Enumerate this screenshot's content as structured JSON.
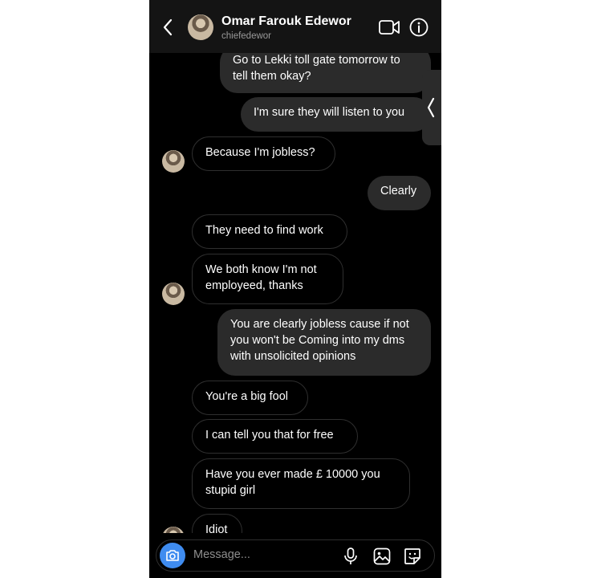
{
  "header": {
    "name": "Omar Farouk Edewor",
    "username": "chiefedewor"
  },
  "messages": [
    {
      "from": "me",
      "text": "Go to Lekki toll gate tomorrow to tell them okay?"
    },
    {
      "from": "me",
      "text": "I'm sure they will listen to you"
    },
    {
      "from": "them",
      "text": "Because I'm jobless?"
    },
    {
      "from": "me",
      "text": "Clearly"
    },
    {
      "from": "them",
      "text": "They need to find work"
    },
    {
      "from": "them",
      "text": "We both know I'm not employeed, thanks"
    },
    {
      "from": "me",
      "text": "You are clearly jobless cause if not you won't be Coming into my dms with unsolicited opinions"
    },
    {
      "from": "them",
      "text": "You're a big fool"
    },
    {
      "from": "them",
      "text": "I can tell you that for free"
    },
    {
      "from": "them",
      "text": "Have you ever made £ 10000 you stupid girl"
    },
    {
      "from": "them",
      "text": "Idiot"
    }
  ],
  "composer": {
    "placeholder": "Message..."
  },
  "icons": {
    "back": "chevron-left-icon",
    "video": "video-call-icon",
    "info": "info-icon",
    "camera": "camera-icon",
    "mic": "microphone-icon",
    "gallery": "gallery-icon",
    "sticker": "sticker-icon"
  },
  "colors": {
    "background": "#000000",
    "sent_bubble": "#2b2b2b",
    "camera_button": "#3f8cf0"
  }
}
